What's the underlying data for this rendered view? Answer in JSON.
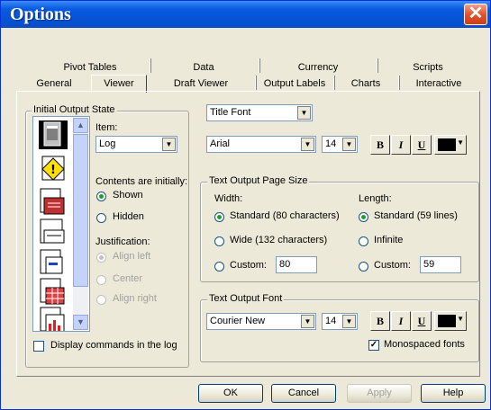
{
  "window": {
    "title": "Options"
  },
  "tabs": {
    "row1": [
      "Pivot Tables",
      "Data",
      "Currency",
      "Scripts"
    ],
    "row2": [
      "General",
      "Viewer",
      "Draft Viewer",
      "Output Labels",
      "Charts",
      "Interactive"
    ],
    "active": "Viewer"
  },
  "initial_state": {
    "group_label": "Initial Output State",
    "icons": [
      "log-icon",
      "warnings-icon",
      "notes-icon",
      "title-icon",
      "page-title-icon",
      "pivot-table-icon",
      "chart-icon"
    ],
    "item_label": "Item:",
    "item_value": "Log",
    "contents_label": "Contents are initially:",
    "shown": "Shown",
    "hidden": "Hidden",
    "justification_label": "Justification:",
    "align_left": "Align left",
    "center": "Center",
    "align_right": "Align right",
    "display_commands": "Display commands in the log"
  },
  "title_font": {
    "selector": "Title Font",
    "font": "Arial",
    "size": "14",
    "bold": "B",
    "italic": "I",
    "underline": "U",
    "color": "#000000"
  },
  "page_size": {
    "group_label": "Text Output Page Size",
    "width_label": "Width:",
    "length_label": "Length:",
    "width_standard": "Standard (80 characters)",
    "width_wide": "Wide (132 characters)",
    "width_custom": "Custom:",
    "width_custom_value": "80",
    "length_standard": "Standard (59 lines)",
    "length_infinite": "Infinite",
    "length_custom": "Custom:",
    "length_custom_value": "59"
  },
  "output_font": {
    "group_label": "Text Output Font",
    "font": "Courier New",
    "size": "14",
    "bold": "B",
    "italic": "I",
    "underline": "U",
    "color": "#000000",
    "monospaced": "Monospaced fonts"
  },
  "buttons": {
    "ok": "OK",
    "cancel": "Cancel",
    "apply": "Apply",
    "help": "Help"
  }
}
